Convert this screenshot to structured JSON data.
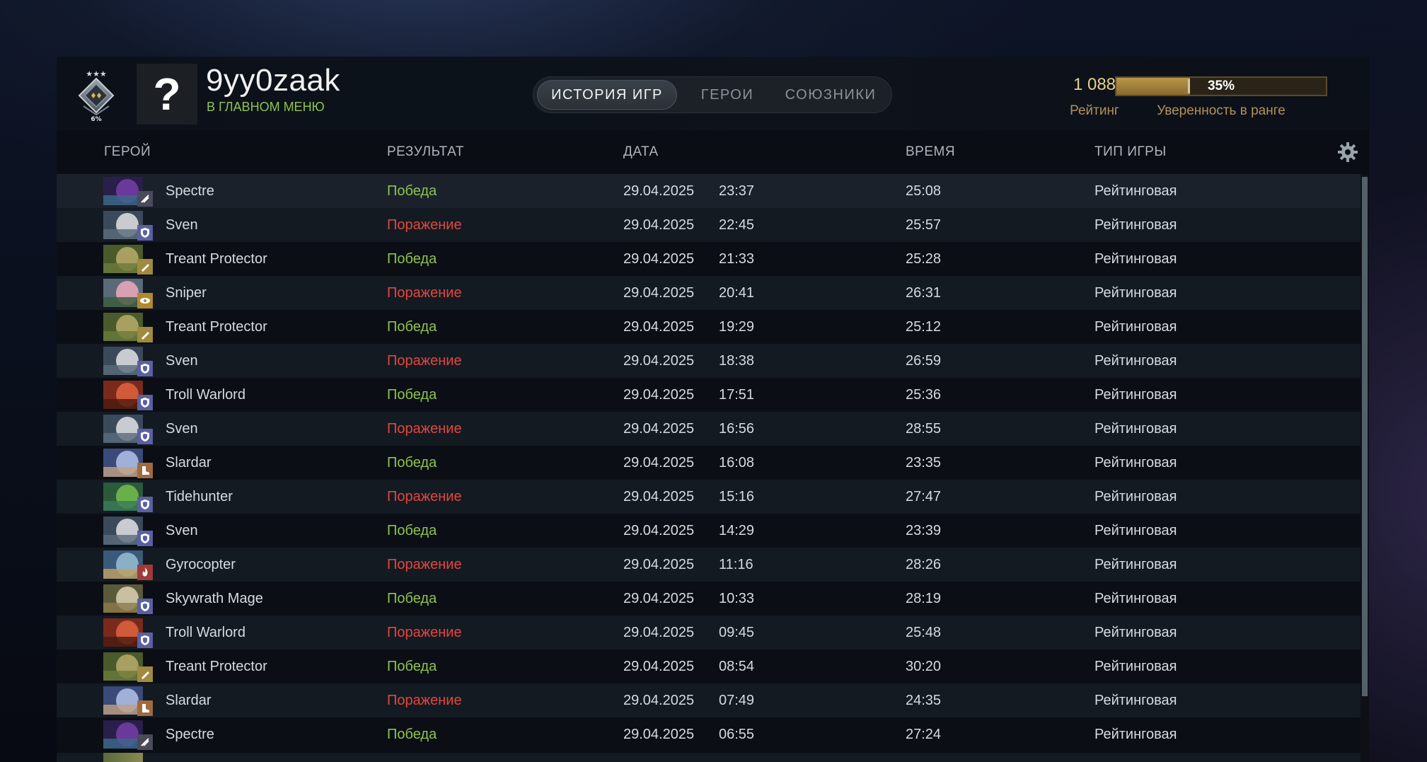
{
  "player": {
    "name": "9yy0zaak",
    "status": "В ГЛАВНОМ МЕНЮ",
    "avatar_glyph": "?",
    "rank_percent_label": "6%",
    "rank_stars": "★★★"
  },
  "tabs": [
    {
      "label": "ИСТОРИЯ ИГР",
      "active": true
    },
    {
      "label": "ГЕРОИ",
      "active": false
    },
    {
      "label": "СОЮЗНИКИ",
      "active": false
    }
  ],
  "rating": {
    "value": "1 088",
    "label": "Рейтинг"
  },
  "confidence": {
    "value_text": "35%",
    "fraction": 0.35,
    "label": "Уверенность в ранге"
  },
  "columns": {
    "hero": "ГЕРОЙ",
    "result": "РЕЗУЛЬТАТ",
    "date": "ДАТА",
    "duration": "ВРЕМЯ",
    "game_type": "ТИП ИГРЫ"
  },
  "matches": [
    {
      "hero": "Spectre",
      "role": "carry-icon",
      "result": "Победа",
      "win": true,
      "date": "29.04.2025",
      "time": "23:37",
      "duration": "25:08",
      "type": "Рейтинговая"
    },
    {
      "hero": "Sven",
      "role": "shield-icon",
      "result": "Поражение",
      "win": false,
      "date": "29.04.2025",
      "time": "22:45",
      "duration": "25:57",
      "type": "Рейтинговая"
    },
    {
      "hero": "Treant Protector",
      "role": "support-icon",
      "result": "Победа",
      "win": true,
      "date": "29.04.2025",
      "time": "21:33",
      "duration": "25:28",
      "type": "Рейтинговая"
    },
    {
      "hero": "Sniper",
      "role": "eye-icon",
      "result": "Поражение",
      "win": false,
      "date": "29.04.2025",
      "time": "20:41",
      "duration": "26:31",
      "type": "Рейтинговая"
    },
    {
      "hero": "Treant Protector",
      "role": "support-icon",
      "result": "Победа",
      "win": true,
      "date": "29.04.2025",
      "time": "19:29",
      "duration": "25:12",
      "type": "Рейтинговая"
    },
    {
      "hero": "Sven",
      "role": "shield-icon",
      "result": "Поражение",
      "win": false,
      "date": "29.04.2025",
      "time": "18:38",
      "duration": "26:59",
      "type": "Рейтинговая"
    },
    {
      "hero": "Troll Warlord",
      "role": "shield-icon",
      "result": "Победа",
      "win": true,
      "date": "29.04.2025",
      "time": "17:51",
      "duration": "25:36",
      "type": "Рейтинговая"
    },
    {
      "hero": "Sven",
      "role": "shield-icon",
      "result": "Поражение",
      "win": false,
      "date": "29.04.2025",
      "time": "16:56",
      "duration": "28:55",
      "type": "Рейтинговая"
    },
    {
      "hero": "Slardar",
      "role": "boot-icon",
      "result": "Победа",
      "win": true,
      "date": "29.04.2025",
      "time": "16:08",
      "duration": "23:35",
      "type": "Рейтинговая"
    },
    {
      "hero": "Tidehunter",
      "role": "shield-icon",
      "result": "Поражение",
      "win": false,
      "date": "29.04.2025",
      "time": "15:16",
      "duration": "27:47",
      "type": "Рейтинговая"
    },
    {
      "hero": "Sven",
      "role": "shield-icon",
      "result": "Победа",
      "win": true,
      "date": "29.04.2025",
      "time": "14:29",
      "duration": "23:39",
      "type": "Рейтинговая"
    },
    {
      "hero": "Gyrocopter",
      "role": "fire-icon",
      "result": "Поражение",
      "win": false,
      "date": "29.04.2025",
      "time": "11:16",
      "duration": "28:26",
      "type": "Рейтинговая"
    },
    {
      "hero": "Skywrath Mage",
      "role": "shield-icon",
      "result": "Победа",
      "win": true,
      "date": "29.04.2025",
      "time": "10:33",
      "duration": "28:19",
      "type": "Рейтинговая"
    },
    {
      "hero": "Troll Warlord",
      "role": "shield-icon",
      "result": "Поражение",
      "win": false,
      "date": "29.04.2025",
      "time": "09:45",
      "duration": "25:48",
      "type": "Рейтинговая"
    },
    {
      "hero": "Treant Protector",
      "role": "support-icon",
      "result": "Победа",
      "win": true,
      "date": "29.04.2025",
      "time": "08:54",
      "duration": "30:20",
      "type": "Рейтинговая"
    },
    {
      "hero": "Slardar",
      "role": "boot-icon",
      "result": "Поражение",
      "win": false,
      "date": "29.04.2025",
      "time": "07:49",
      "duration": "24:35",
      "type": "Рейтинговая"
    },
    {
      "hero": "Spectre",
      "role": "carry-icon",
      "result": "Победа",
      "win": true,
      "date": "29.04.2025",
      "time": "06:55",
      "duration": "27:24",
      "type": "Рейтинговая"
    }
  ],
  "colors": {
    "win": "#8fc24f",
    "loss": "#e2473e",
    "gold": "#e8cf8c",
    "gold_label": "#b39159"
  }
}
